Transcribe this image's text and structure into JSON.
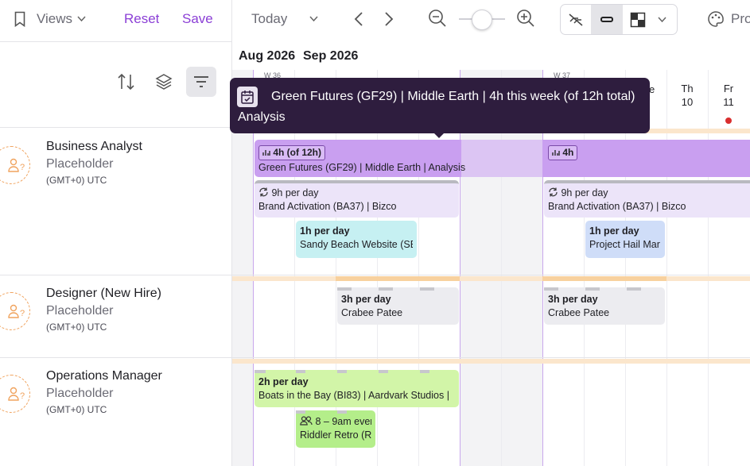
{
  "toolbar": {
    "views_label": "Views",
    "reset_label": "Reset",
    "save_label": "Save",
    "today_label": "Today",
    "profile_label": "Pro"
  },
  "timeline": {
    "month_left": "Aug 2026",
    "month_right": "Sep 2026",
    "week_left": "W 36",
    "week_right": "W 37",
    "day_thu": "Th",
    "day_thu_num": "10",
    "day_fri": "Fr",
    "day_fri_num": "11",
    "partial_day": "e"
  },
  "tooltip": {
    "line1": "Green Futures (GF29) | Middle Earth | 4h this week (of 12h total)",
    "line2": "Analysis"
  },
  "people": [
    {
      "name": "Business Analyst",
      "role": "Placeholder",
      "tz": "(GMT+0) UTC"
    },
    {
      "name": "Designer (New Hire)",
      "role": "Placeholder",
      "tz": "(GMT+0) UTC"
    },
    {
      "name": "Operations Manager",
      "role": "Placeholder",
      "tz": "(GMT+0) UTC"
    }
  ],
  "blocks": {
    "ba_green_badge_a": "4h (of 12h)",
    "ba_green_badge_b": "4h",
    "ba_green_title": "Green Futures (GF29) | Middle Earth | Analysis",
    "ba_brand_hours": "9h per day",
    "ba_brand_title": "Brand Activation (BA37) | Bizco",
    "ba_sandy_hours": "1h per day",
    "ba_sandy_title": "Sandy Beach Website (SB",
    "ba_hail_hours": "1h per day",
    "ba_hail_title": "Project Hail Mar",
    "des_hours": "3h per day",
    "des_title": "Crabee Patee",
    "ops_boats_hours": "2h per day",
    "ops_boats_title": "Boats in the Bay (BI83) | Aardvark Studios |",
    "ops_riddler_hours": "8 – 9am ever",
    "ops_riddler_title": "Riddler Retro (R"
  },
  "colors": {
    "accent": "#8b3fd6",
    "tooltip_bg": "#2e1d3e",
    "green_futures": "#c99ff0",
    "brand": "#ece4f9",
    "sandy": "#c6f0f2",
    "hail": "#cfddf8",
    "crabee": "#ececf0",
    "boats": "#d2f5a8",
    "today_dot": "#d92e2e"
  }
}
